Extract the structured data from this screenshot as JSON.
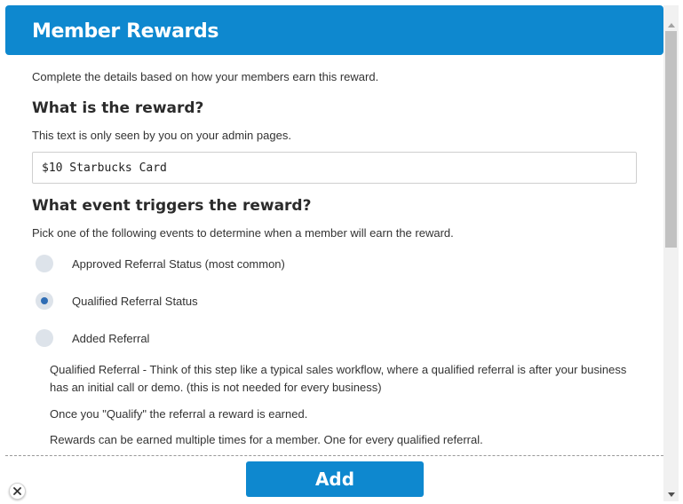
{
  "header": {
    "title": "Member Rewards"
  },
  "intro": "Complete the details based on how your members earn this reward.",
  "reward": {
    "question": "What is the reward?",
    "hint": "This text is only seen by you on your admin pages.",
    "value": "$10 Starbucks Card"
  },
  "trigger": {
    "question": "What event triggers the reward?",
    "hint": "Pick one of the following events to determine when a member will earn the reward.",
    "options": [
      {
        "label": "Approved Referral Status (most common)",
        "checked": false
      },
      {
        "label": "Qualified Referral Status",
        "checked": true
      },
      {
        "label": "Added Referral",
        "checked": false
      }
    ],
    "notes": [
      "Qualified Referral - Think of this step like a typical sales workflow, where a qualified referral is after your business has an initial call or demo. (this is not needed for every business)",
      "Once you \"Qualify\" the referral a reward is earned.",
      "Rewards can be earned multiple times for a member. One for every qualified referral."
    ]
  },
  "footer": {
    "add_label": "Add"
  },
  "icons": {
    "close": "close-icon",
    "scroll_up": "arrow-up-icon",
    "scroll_down": "arrow-down-icon"
  },
  "colors": {
    "accent": "#0e88cf",
    "radio_checked": "#2f6db5",
    "radio_bg": "#dde3ea"
  }
}
